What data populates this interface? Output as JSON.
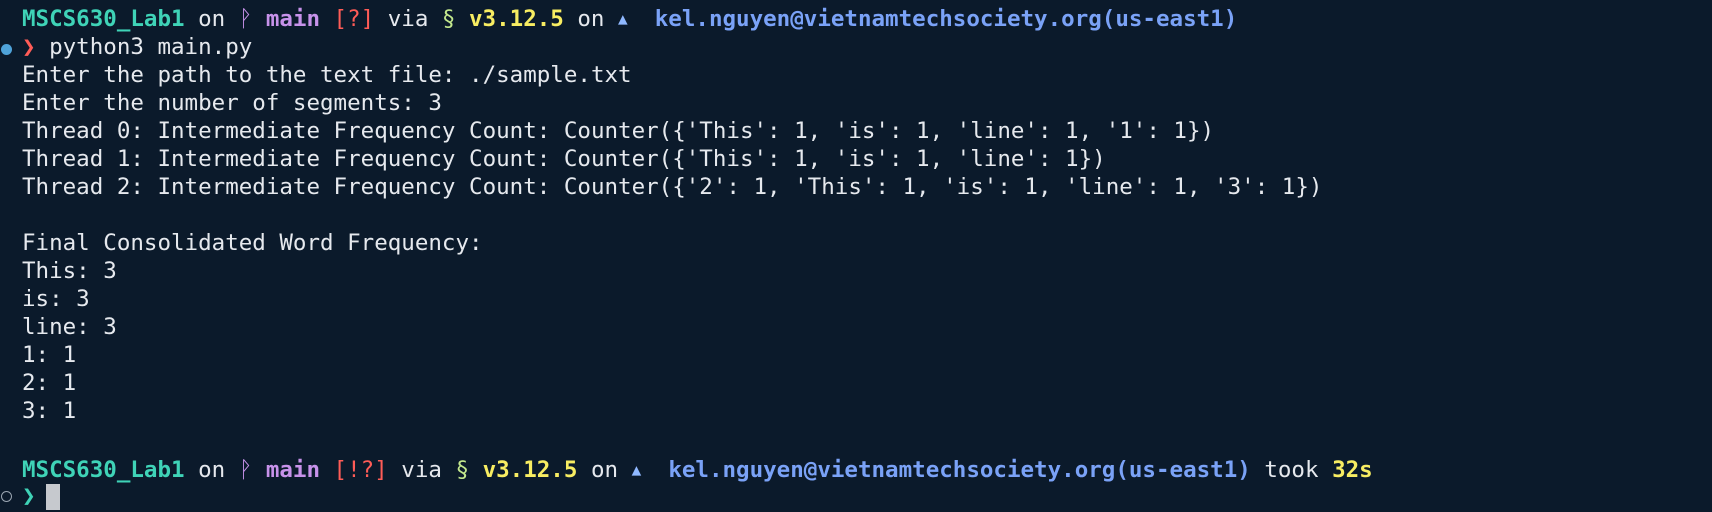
{
  "prompt1": {
    "dir": "MSCS630_Lab1",
    "on": "on",
    "branch_icon": "branch-icon",
    "branch": "main",
    "status": "[?]",
    "via": "via",
    "python_icon": "python-snake-icon",
    "version": "v3.12.5",
    "on2": "on",
    "cloud_icon": "cloud-icon",
    "account": "kel.nguyen@vietnamtechsociety.org(us-east1)"
  },
  "command": {
    "arrow": "❯",
    "text": "python3 main.py"
  },
  "output": [
    "Enter the path to the text file: ./sample.txt",
    "Enter the number of segments: 3",
    "Thread 0: Intermediate Frequency Count: Counter({'This': 1, 'is': 1, 'line': 1, '1': 1})",
    "Thread 1: Intermediate Frequency Count: Counter({'This': 1, 'is': 1, 'line': 1})",
    "Thread 2: Intermediate Frequency Count: Counter({'2': 1, 'This': 1, 'is': 1, 'line': 1, '3': 1})",
    "",
    "Final Consolidated Word Frequency:",
    "This: 3",
    "is: 3",
    "line: 3",
    "1: 1",
    "2: 1",
    "3: 1"
  ],
  "prompt2": {
    "dir": "MSCS630_Lab1",
    "on": "on",
    "branch": "main",
    "status": "[!?]",
    "via": "via",
    "version": "v3.12.5",
    "on2": "on",
    "account": "kel.nguyen@vietnamtechsociety.org(us-east1)",
    "took": "took",
    "duration": "32s"
  },
  "final_prompt": {
    "arrow": "❯"
  },
  "colors": {
    "background": "#0b1a2b",
    "dir": "#3fd3b7",
    "branch": "#c792ea",
    "status": "#ff5c57",
    "version": "#f8ed62",
    "account": "#7aa2f7"
  }
}
